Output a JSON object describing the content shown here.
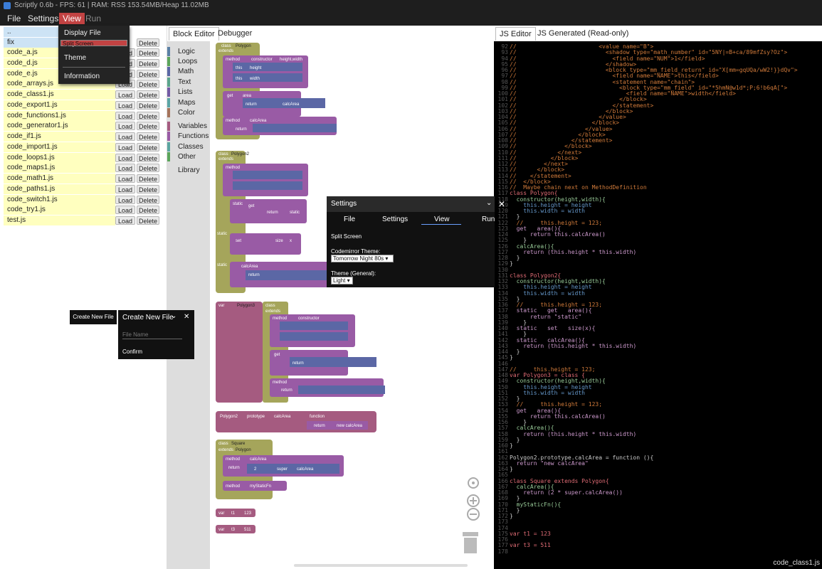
{
  "window": {
    "title": "Scriptly 0.6b - FPS: 61 | RAM: RSS 153.54MB/Heap 11.02MB"
  },
  "menubar": {
    "file": "File",
    "settings": "Settings",
    "view": "View",
    "run": "Run"
  },
  "view_menu": {
    "display_file_explorer": "Display File Explorer",
    "split_screen": "Split Screen",
    "theme": "Theme",
    "information": "Information"
  },
  "file_explorer": {
    "parent": "..",
    "folder": "fix",
    "load_label": "Load",
    "delete_label": "Delete",
    "files": [
      "code_a.js",
      "code_d.js",
      "code_e.js",
      "code_arrays.js",
      "code_class1.js",
      "code_export1.js",
      "code_functions1.js",
      "code_generator1.js",
      "code_if1.js",
      "code_import1.js",
      "code_loops1.js",
      "code_maps1.js",
      "code_math1.js",
      "code_paths1.js",
      "code_switch1.js",
      "code_try1.js",
      "test.js"
    ]
  },
  "block_editor": {
    "tabs": [
      "Block Editor",
      "Debugger"
    ],
    "toolbox": [
      {
        "label": "Logic",
        "color": "#5b80a5"
      },
      {
        "label": "Loops",
        "color": "#5ba55b"
      },
      {
        "label": "Math",
        "color": "#5b67a5"
      },
      {
        "label": "Text",
        "color": "#5ba58c"
      },
      {
        "label": "Lists",
        "color": "#745ba5"
      },
      {
        "label": "Maps",
        "color": "#5ba5a5"
      },
      {
        "label": "Color",
        "color": "#a5745b"
      },
      {
        "label": "Variables",
        "color": "#a55b80"
      },
      {
        "label": "Functions",
        "color": "#995ba5"
      },
      {
        "label": "Classes",
        "color": "#5ba5a0"
      },
      {
        "label": "Other",
        "color": "#5ba55b"
      },
      {
        "label": "Library",
        "color": ""
      }
    ],
    "blocks": {
      "class1": "Polygon",
      "class2": "Polygon2",
      "class3": "Polygon3",
      "class4": "Square",
      "var_t1": "t1",
      "var_t1_val": "123",
      "var_t3": "t3",
      "var_t3_val": "511",
      "kw_class": "class",
      "kw_extends": "extends",
      "kw_method": "method",
      "kw_constructor": "constructor",
      "kw_get": "get",
      "kw_set": "set",
      "kw_static": "static",
      "kw_return": "return",
      "kw_var": "var",
      "kw_this": "this",
      "kw_height": "height",
      "kw_width": "width",
      "kw_area": "area",
      "kw_calcArea": "calcArea",
      "kw_size": "size",
      "kw_function": "function",
      "kw_prototype": "prototype",
      "kw_super": "super",
      "kw_myStaticFn": "myStaticFn",
      "kw_new_calcArea": "new calcArea",
      "kw_static_str": "static",
      "kw_height_width": "height,width",
      "kw_x": "x",
      "kw_2": "2"
    }
  },
  "js_editor": {
    "tabs": [
      "JS Editor",
      "JS Generated (Read-only)"
    ],
    "filename": "code_class1.js",
    "lines": [
      {
        "n": "92",
        "t": "//                        <value name=\"B\">"
      },
      {
        "n": "93",
        "t": "//                          <shadow type=\"math_number\" id=\"5NY|=B+ca/89mfZsy?Oz\">"
      },
      {
        "n": "94",
        "t": "//                            <field name=\"NUM\">1</field>"
      },
      {
        "n": "95",
        "t": "//                          </shadow>"
      },
      {
        "n": "96",
        "t": "//                          <block type=\"mm_field_return\" id=\"X[mm=gqUQa/wW2!}}dQv\">"
      },
      {
        "n": "97",
        "t": "//                            <field name=\"NAME\">this</field>"
      },
      {
        "n": "98",
        "t": "//                            <statement name=\"chain\">"
      },
      {
        "n": "99",
        "t": "//                              <block type=\"mm_field\" id=\"*5hmN@w1d*;P;6!b6qA[\">"
      },
      {
        "n": "100",
        "t": "//                                <field name=\"NAME\">width</field>"
      },
      {
        "n": "101",
        "t": "//                              </block>"
      },
      {
        "n": "102",
        "t": "//                            </statement>"
      },
      {
        "n": "103",
        "t": "//                          </block>"
      },
      {
        "n": "104",
        "t": "//                        </value>"
      },
      {
        "n": "105",
        "t": "//                      </block>"
      },
      {
        "n": "106",
        "t": "//                    </value>"
      },
      {
        "n": "107",
        "t": "//                  </block>"
      },
      {
        "n": "108",
        "t": "//                </statement>"
      },
      {
        "n": "109",
        "t": "//              </block>"
      },
      {
        "n": "110",
        "t": "//            </next>"
      },
      {
        "n": "111",
        "t": "//          </block>"
      },
      {
        "n": "112",
        "t": "//        </next>"
      },
      {
        "n": "113",
        "t": "//      </block>"
      },
      {
        "n": "114",
        "t": "//    </statement>"
      },
      {
        "n": "115",
        "t": "//  </block>"
      },
      {
        "n": "116",
        "t": "//  Maybe chain next on MethodDefinition"
      },
      {
        "n": "117",
        "t": "class Polygon{"
      },
      {
        "n": "118",
        "t": "  constructor(height,width){"
      },
      {
        "n": "119",
        "t": "    this.height = height"
      },
      {
        "n": "120",
        "t": "    this.width = width"
      },
      {
        "n": "121",
        "t": "  }"
      },
      {
        "n": "122",
        "t": "  //     this.height = 123;"
      },
      {
        "n": "123",
        "t": "  get   area(){"
      },
      {
        "n": "124",
        "t": "      return this.calcArea()"
      },
      {
        "n": "125",
        "t": "    }"
      },
      {
        "n": "126",
        "t": "  calcArea(){"
      },
      {
        "n": "127",
        "t": "    return (this.height * this.width)"
      },
      {
        "n": "128",
        "t": "  }"
      },
      {
        "n": "129",
        "t": "}"
      },
      {
        "n": "130",
        "t": ""
      },
      {
        "n": "131",
        "t": "class Polygon2{"
      },
      {
        "n": "132",
        "t": "  constructor(height,width){"
      },
      {
        "n": "133",
        "t": "    this.height = height"
      },
      {
        "n": "134",
        "t": "    this.width = width"
      },
      {
        "n": "135",
        "t": "  }"
      },
      {
        "n": "136",
        "t": "  //     this.height = 123;"
      },
      {
        "n": "137",
        "t": "  static   get   area(){"
      },
      {
        "n": "138",
        "t": "      return \"static\""
      },
      {
        "n": "139",
        "t": "    }"
      },
      {
        "n": "140",
        "t": "  static   set   size(x){"
      },
      {
        "n": "141",
        "t": "    }"
      },
      {
        "n": "142",
        "t": "  static   calcArea(){"
      },
      {
        "n": "143",
        "t": "    return (this.height * this.width)"
      },
      {
        "n": "144",
        "t": "  }"
      },
      {
        "n": "145",
        "t": "}"
      },
      {
        "n": "146",
        "t": ""
      },
      {
        "n": "147",
        "t": "//     this.height = 123;"
      },
      {
        "n": "148",
        "t": "var Polygon3 = class {"
      },
      {
        "n": "149",
        "t": "  constructor(height,width){"
      },
      {
        "n": "150",
        "t": "    this.height = height"
      },
      {
        "n": "151",
        "t": "    this.width = width"
      },
      {
        "n": "152",
        "t": "  }"
      },
      {
        "n": "153",
        "t": "  //     this.height = 123;"
      },
      {
        "n": "154",
        "t": "  get   area(){"
      },
      {
        "n": "155",
        "t": "      return this.calcArea()"
      },
      {
        "n": "156",
        "t": "    }"
      },
      {
        "n": "157",
        "t": "  calcArea(){"
      },
      {
        "n": "158",
        "t": "    return (this.height * this.width)"
      },
      {
        "n": "159",
        "t": "  }"
      },
      {
        "n": "160",
        "t": "}"
      },
      {
        "n": "161",
        "t": ""
      },
      {
        "n": "162",
        "t": "Polygon2.prototype.calcArea = function (){"
      },
      {
        "n": "163",
        "t": "  return \"new calcArea\""
      },
      {
        "n": "164",
        "t": "}"
      },
      {
        "n": "165",
        "t": ""
      },
      {
        "n": "166",
        "t": "class Square extends Polygon{"
      },
      {
        "n": "167",
        "t": "  calcArea(){"
      },
      {
        "n": "168",
        "t": "    return (2 * super.calcArea())"
      },
      {
        "n": "169",
        "t": "  }"
      },
      {
        "n": "170",
        "t": "  myStaticFn(){"
      },
      {
        "n": "171",
        "t": "  }"
      },
      {
        "n": "172",
        "t": "}"
      },
      {
        "n": "173",
        "t": ""
      },
      {
        "n": "174",
        "t": ""
      },
      {
        "n": "175",
        "t": "var t1 = 123"
      },
      {
        "n": "176",
        "t": ""
      },
      {
        "n": "177",
        "t": "var t3 = 511"
      },
      {
        "n": "178",
        "t": ""
      }
    ]
  },
  "settings": {
    "title": "Settings",
    "tabs": [
      "File",
      "Settings",
      "View",
      "Run"
    ],
    "split_screen": "Split Screen",
    "codemirror_label": "Codemirror Theme:",
    "codemirror_value": "Tomorrow Night 80s",
    "theme_label": "Theme (General):",
    "theme_value": "Light"
  },
  "create_file": {
    "button": "Create New File",
    "title": "Create New File",
    "placeholder": "File Name",
    "confirm": "Confirm"
  },
  "colors": {
    "accent": "#c24343",
    "class_block": "#a5a55b",
    "method_block": "#995ba5",
    "var_block": "#a55b80",
    "this_block": "#5b67a5"
  }
}
